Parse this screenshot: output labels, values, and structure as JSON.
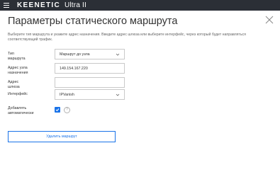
{
  "header": {
    "brand": "KEENETIC",
    "model": "Ultra II",
    "brand_color": "#2b2f36"
  },
  "dialog": {
    "title": "Параметры статического маршрута",
    "description": "Выберите тип маршрута и укажите адрес назначения. Введите адрес шлюза или выберите интерфейс, через который будет направляться соответствующий трафик.",
    "accent_color": "#1a73e8"
  },
  "form": {
    "route_type": {
      "label": "Тип маршрута",
      "value": "Маршрут до узла"
    },
    "destination": {
      "label": "Адрес узла назначения",
      "value": "149.154.167.220"
    },
    "gateway": {
      "label": "Адрес шлюза",
      "value": ""
    },
    "interface": {
      "label": "Интерфейс",
      "value": "IPVanish"
    },
    "auto_add": {
      "label": "Добавлять автоматически",
      "checked": true,
      "help": "?"
    }
  },
  "actions": {
    "delete_label": "Удалить маршрут"
  }
}
